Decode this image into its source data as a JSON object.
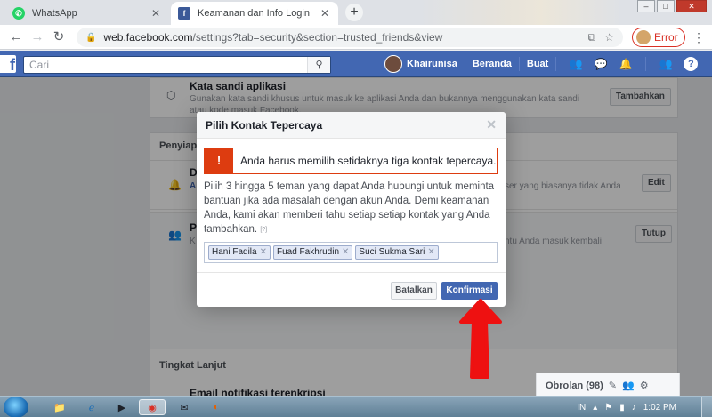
{
  "browser": {
    "tabs": [
      {
        "title": "WhatsApp",
        "icon": "whatsapp-icon"
      },
      {
        "title": "Keamanan dan Info Login",
        "icon": "facebook-icon"
      }
    ],
    "url_host": "web.facebook.com",
    "url_path": "/settings?tab=security&section=trusted_friends&view",
    "profile_status": "Error"
  },
  "facebook": {
    "logo": "f",
    "search_placeholder": "Cari",
    "user_name": "Khairunisa",
    "nav": [
      "Beranda",
      "Buat"
    ]
  },
  "settings": {
    "app_password_title": "Kata sandi aplikasi",
    "app_password_desc": "Gunakan kata sandi khusus untuk masuk ke aplikasi Anda dan bukannya menggunakan kata sandi atau kode masuk Facebook.",
    "add_button": "Tambahkan",
    "section_partial": "Penyiapan",
    "row1_title_partial": "D",
    "row1_desc_partial_left": "Al",
    "row1_desc_partial_right": "ser yang biasanya tidak Anda",
    "edit_button": "Edit",
    "row2_title_partial": "P",
    "row2_desc_partial_left": "K",
    "row2_desc_partial_right": "ntu Anda masuk kembali",
    "close_button": "Tutup",
    "advanced_section": "Tingkat Lanjut",
    "encrypted_email_title": "Email notifikasi terenkripsi"
  },
  "modal": {
    "title": "Pilih Kontak Tepercaya",
    "error_message": "Anda harus memilih setidaknya tiga kontak tepercaya.",
    "body": "Pilih 3 hingga 5 teman yang dapat Anda hubungi untuk meminta bantuan jika ada masalah dengan akun Anda. Demi keamanan Anda, kami akan memberi tahu setiap setiap kontak yang Anda tambahkan.",
    "help_marker": "[?]",
    "selected_contacts": [
      "Hani Fadila",
      "Fuad Fakhrudin",
      "Suci Sukma Sari"
    ],
    "cancel_label": "Batalkan",
    "confirm_label": "Konfirmasi"
  },
  "chat": {
    "label": "Obrolan (98)"
  },
  "taskbar": {
    "language": "IN",
    "time": "1:02 PM"
  },
  "colors": {
    "fb_blue": "#4267b2",
    "error_red": "#dd3c10",
    "annotation_red": "#ee1111"
  }
}
